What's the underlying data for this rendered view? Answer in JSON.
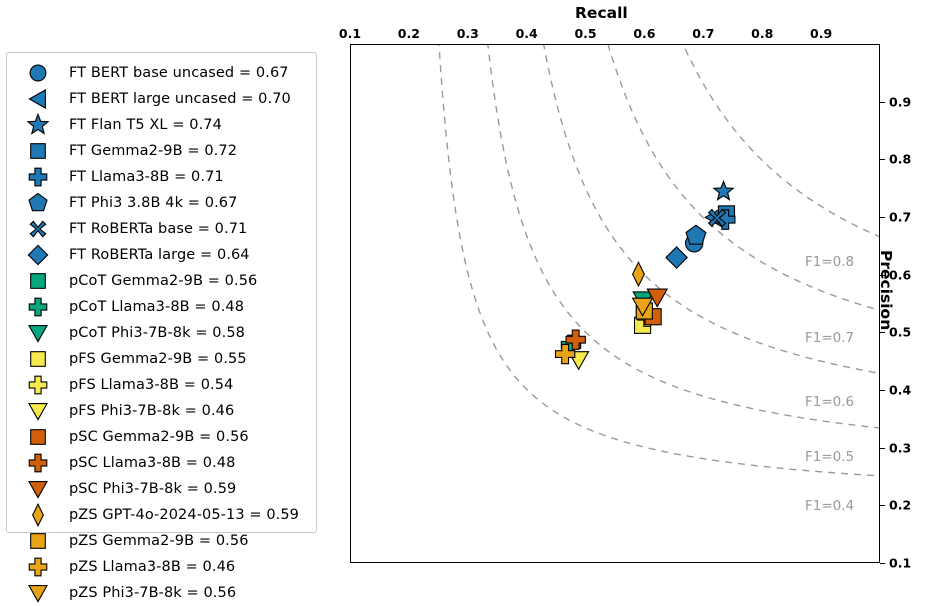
{
  "chart_data": {
    "type": "scatter",
    "title": "",
    "xlabel": "Recall",
    "ylabel": "Precision",
    "xlim": [
      0.1,
      1.0
    ],
    "ylim": [
      0.1,
      1.0
    ],
    "xticks": [
      "0.1",
      "0.2",
      "0.3",
      "0.4",
      "0.5",
      "0.6",
      "0.7",
      "0.8",
      "0.9"
    ],
    "yticks": [
      "0.1",
      "0.2",
      "0.3",
      "0.4",
      "0.5",
      "0.6",
      "0.7",
      "0.8",
      "0.9"
    ],
    "grid": false,
    "legend_position": "outside-left",
    "iso_f1_curves": [
      {
        "label": "F1=0.8",
        "value": 0.8
      },
      {
        "label": "F1=0.7",
        "value": 0.7
      },
      {
        "label": "F1=0.6",
        "value": 0.6
      },
      {
        "label": "F1=0.5",
        "value": 0.5
      },
      {
        "label": "F1=0.4",
        "value": 0.4
      }
    ],
    "series": [
      {
        "name": "FT BERT base uncased",
        "label": "FT BERT base uncased = 0.67",
        "f1": 0.67,
        "recall": 0.685,
        "precision": 0.655,
        "marker": "circle",
        "color": "#1f77b4"
      },
      {
        "name": "FT BERT large uncased",
        "label": "FT BERT large uncased = 0.70",
        "f1": 0.7,
        "recall": 0.72,
        "precision": 0.7,
        "marker": "triangle-left",
        "color": "#1f77b4"
      },
      {
        "name": "FT Flan T5 XL",
        "label": "FT Flan T5 XL = 0.74",
        "f1": 0.74,
        "recall": 0.735,
        "precision": 0.745,
        "marker": "star",
        "color": "#1f77b4"
      },
      {
        "name": "FT Gemma2-9B",
        "label": "FT Gemma2-9B = 0.72",
        "f1": 0.72,
        "recall": 0.74,
        "precision": 0.706,
        "marker": "square",
        "color": "#1f77b4"
      },
      {
        "name": "FT Llama3-8B",
        "label": "FT Llama3-8B = 0.71",
        "f1": 0.71,
        "recall": 0.738,
        "precision": 0.696,
        "marker": "plus",
        "color": "#1f77b4"
      },
      {
        "name": "FT Phi3 3.8B 4k",
        "label": "FT Phi3 3.8B 4k = 0.67",
        "f1": 0.67,
        "recall": 0.688,
        "precision": 0.668,
        "marker": "pentagon",
        "color": "#1f77b4"
      },
      {
        "name": "FT RoBERTa base",
        "label": "FT RoBERTa base = 0.71",
        "f1": 0.71,
        "recall": 0.724,
        "precision": 0.699,
        "marker": "x",
        "color": "#1f77b4"
      },
      {
        "name": "FT RoBERTa large",
        "label": "FT RoBERTa large = 0.64",
        "f1": 0.64,
        "recall": 0.655,
        "precision": 0.63,
        "marker": "diamond",
        "color": "#1f77b4"
      },
      {
        "name": "pCoT Gemma2-9B",
        "label": "pCoT Gemma2-9B = 0.56",
        "f1": 0.56,
        "recall": 0.6,
        "precision": 0.53,
        "marker": "square",
        "color": "#06a77d"
      },
      {
        "name": "pCoT Llama3-8B",
        "label": "pCoT Llama3-8B = 0.48",
        "f1": 0.48,
        "recall": 0.475,
        "precision": 0.478,
        "marker": "plus",
        "color": "#06a77d"
      },
      {
        "name": "pCoT Phi3-7B-8k",
        "label": "pCoT Phi3-7B-8k = 0.58",
        "f1": 0.58,
        "recall": 0.598,
        "precision": 0.556,
        "marker": "triangle-down",
        "color": "#06a77d"
      },
      {
        "name": "pFS Gemma2-9B",
        "label": "pFS Gemma2-9B = 0.55",
        "f1": 0.55,
        "recall": 0.597,
        "precision": 0.512,
        "marker": "square",
        "color": "#f5e94e"
      },
      {
        "name": "pFS Llama3-8B",
        "label": "pFS Llama3-8B = 0.54",
        "f1": 0.54,
        "recall": 0.605,
        "precision": 0.527,
        "marker": "plus",
        "color": "#f5e94e"
      },
      {
        "name": "pFS Phi3-7B-8k",
        "label": "pFS Phi3-7B-8k = 0.46",
        "f1": 0.46,
        "recall": 0.488,
        "precision": 0.452,
        "marker": "triangle-down",
        "color": "#f5e94e"
      },
      {
        "name": "pSC Gemma2-9B",
        "label": "pSC Gemma2-9B = 0.56",
        "f1": 0.56,
        "recall": 0.615,
        "precision": 0.527,
        "marker": "square",
        "color": "#d2600a"
      },
      {
        "name": "pSC Llama3-8B",
        "label": "pSC Llama3-8B = 0.48",
        "f1": 0.48,
        "recall": 0.483,
        "precision": 0.487,
        "marker": "plus",
        "color": "#d2600a"
      },
      {
        "name": "pSC Phi3-7B-8k",
        "label": "pSC Phi3-7B-8k = 0.59",
        "f1": 0.59,
        "recall": 0.622,
        "precision": 0.561,
        "marker": "triangle-down",
        "color": "#d2600a"
      },
      {
        "name": "pZS GPT-4o-2024-05-13",
        "label": "pZS GPT-4o-2024-05-13 = 0.59",
        "f1": 0.59,
        "recall": 0.59,
        "precision": 0.601,
        "marker": "thin-diamond",
        "color": "#e8a317"
      },
      {
        "name": "pZS Gemma2-9B",
        "label": "pZS Gemma2-9B = 0.56",
        "f1": 0.56,
        "recall": 0.6,
        "precision": 0.537,
        "marker": "square",
        "color": "#e8a317"
      },
      {
        "name": "pZS Llama3-8B",
        "label": "pZS Llama3-8B = 0.46",
        "f1": 0.46,
        "recall": 0.465,
        "precision": 0.462,
        "marker": "plus",
        "color": "#e8a317"
      },
      {
        "name": "pZS Phi3-7B-8k",
        "label": "pZS Phi3-7B-8k = 0.56",
        "f1": 0.56,
        "recall": 0.597,
        "precision": 0.545,
        "marker": "triangle-down",
        "color": "#e8a317"
      }
    ]
  }
}
